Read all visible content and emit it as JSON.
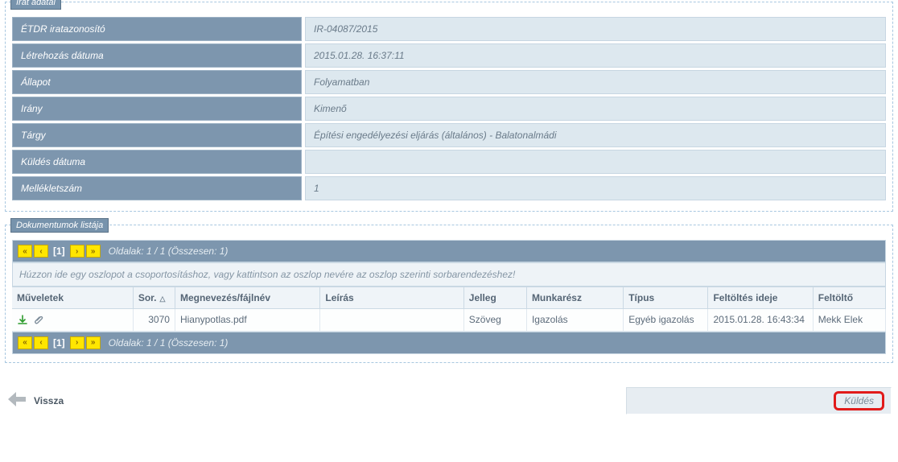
{
  "panel1": {
    "legend": "Irat adatai"
  },
  "details": [
    {
      "label": "ÉTDR iratazonosító",
      "value": "IR-04087/2015"
    },
    {
      "label": "Létrehozás dátuma",
      "value": "2015.01.28. 16:37:11"
    },
    {
      "label": "Állapot",
      "value": "Folyamatban"
    },
    {
      "label": "Irány",
      "value": "Kimenő"
    },
    {
      "label": "Tárgy",
      "value": "Építési engedélyezési eljárás (általános) - Balatonalmádi"
    },
    {
      "label": "Küldés dátuma",
      "value": ""
    },
    {
      "label": "Mellékletszám",
      "value": "1"
    }
  ],
  "panel2": {
    "legend": "Dokumentumok listája"
  },
  "pager": {
    "first": "«",
    "prev": "‹",
    "current": "[1]",
    "next": "›",
    "last": "»",
    "info": "Oldalak: 1 / 1 (Összesen: 1)"
  },
  "grouphint": "Húzzon ide egy oszlopot a csoportosításhoz, vagy kattintson az oszlop nevére az oszlop szerinti sorbarendezéshez!",
  "grid": {
    "cols": {
      "ops": "Műveletek",
      "sor": "Sor.",
      "name": "Megnevezés/fájlnév",
      "desc": "Leírás",
      "jelleg": "Jelleg",
      "munka": "Munkarész",
      "tipus": "Típus",
      "time": "Feltöltés ideje",
      "user": "Feltöltő"
    },
    "sort_asc_mark": "△",
    "row": {
      "sor": "3070",
      "name": "Hianypotlas.pdf",
      "desc": "",
      "jelleg": "Szöveg",
      "munka": "Igazolás",
      "tipus": "Egyéb igazolás",
      "time": "2015.01.28. 16:43:34",
      "user": "Mekk Elek"
    }
  },
  "footer": {
    "back": "Vissza",
    "send": "Küldés"
  }
}
